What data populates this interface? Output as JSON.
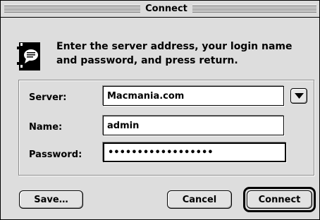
{
  "window": {
    "title": "Connect"
  },
  "message": "Enter the server address, your login name and password, and press return.",
  "icons": {
    "app": "server-connect-icon",
    "dropdown": "triangle-down-icon"
  },
  "form": {
    "server_label": "Server:",
    "server_value": "Macmania.com",
    "name_label": "Name:",
    "name_value": "admin",
    "password_label": "Password:",
    "password_value": "••••••••••••••••••"
  },
  "buttons": {
    "save": "Save…",
    "cancel": "Cancel",
    "connect": "Connect"
  }
}
